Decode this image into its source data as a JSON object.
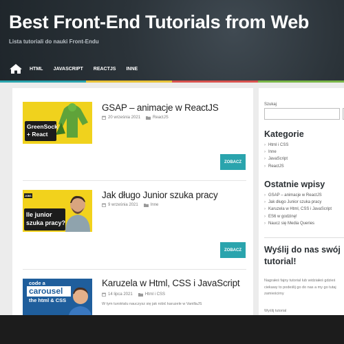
{
  "header": {
    "site_title": "Best Front-End Tutorials from Web",
    "tagline": "Lista tutoriali do nauki Front-Endu",
    "nav": [
      "HTML",
      "JAVASCRIPT",
      "REACTJS",
      "INNE"
    ],
    "stripe_colors": [
      "#2aa4ad",
      "#e8c33a",
      "#d9534f",
      "#7ab648"
    ],
    "home_icon": "home-icon"
  },
  "posts": [
    {
      "title": "GSAP – animacje w ReactJS",
      "date": "20 września 2021",
      "category": "ReactJS",
      "thumb_text": [
        "GreenSock",
        "+ React"
      ],
      "more": "ZOBACZ"
    },
    {
      "title": "Jak długo Junior szuka pracy",
      "date": "9 września 2021",
      "category": "Inne",
      "thumb_badge": "JOBS",
      "thumb_text": [
        "Ile junior",
        "szuka pracy?"
      ],
      "more": "ZOBACZ"
    },
    {
      "title": "Karuzela w Html, CSS i JavaScript",
      "date": "14 lipca 2021",
      "category": "Html i CSS",
      "excerpt": "W tym turotrialu nauczysz się jak robić karuzele w VanillaJS",
      "thumb_text": [
        "code a",
        "carousel",
        "the html & CSS"
      ]
    }
  ],
  "sidebar": {
    "search_label": "Szukaj",
    "categories_title": "Kategorie",
    "categories": [
      "Html i CSS",
      "Inne",
      "JavaScript",
      "ReactJS"
    ],
    "recent_title": "Ostatnie wpisy",
    "recent": [
      "GSAP – animacje w ReactJS",
      "Jak długo Junior szuka pracy",
      "Karuzela w Html, CSS i JavaScript",
      "ES6 w godzinę!",
      "Naucz się Media Queries"
    ],
    "cta_title_line1": "Wyślij do nas swój",
    "cta_title_line2": "tutorial!",
    "cta_line1": "Nagrałeś fajny tutorial lub widziałeś gdzieś",
    "cta_line2": "ciekawy to podeślij go do nas a my go tutaj",
    "cta_line3": "zamieścimy",
    "cta_label": "Wyślij tutorial"
  }
}
